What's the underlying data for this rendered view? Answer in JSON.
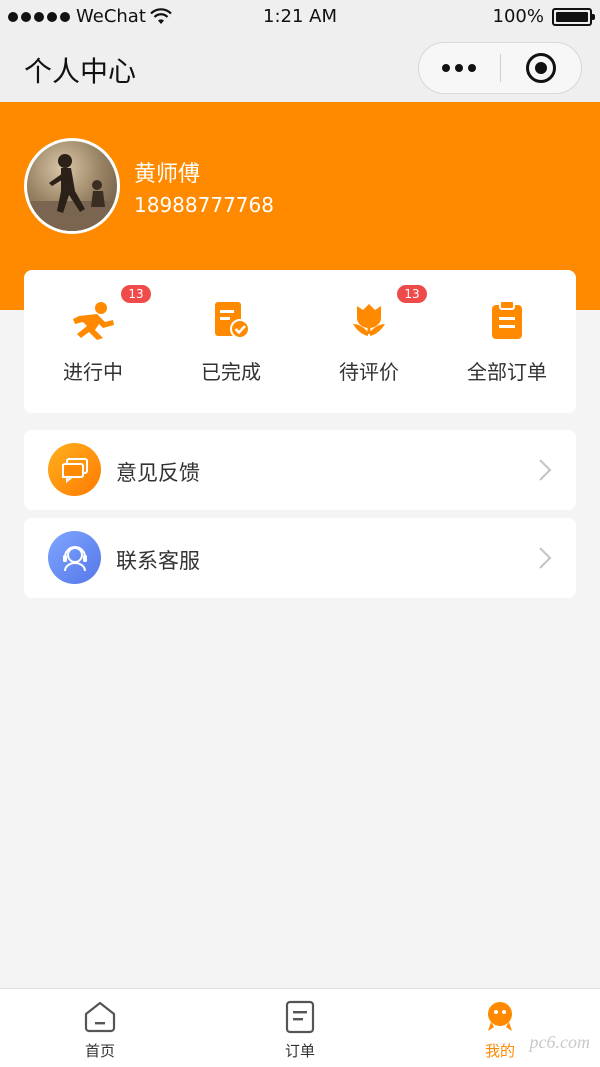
{
  "status_bar": {
    "carrier": "WeChat",
    "time": "1:21 AM",
    "battery": "100%"
  },
  "nav": {
    "title": "个人中心",
    "more_icon": "more-dots-icon",
    "close_icon": "target-circle-icon"
  },
  "profile": {
    "name": "黄师傅",
    "phone": "18988777768",
    "header_color": "#ff8a00"
  },
  "orders": {
    "items": [
      {
        "label": "进行中",
        "icon": "running-man-icon",
        "badge": "13"
      },
      {
        "label": "已完成",
        "icon": "document-check-icon",
        "badge": ""
      },
      {
        "label": "待评价",
        "icon": "flower-icon",
        "badge": "13"
      },
      {
        "label": "全部订单",
        "icon": "clipboard-icon",
        "badge": ""
      }
    ]
  },
  "menu": {
    "items": [
      {
        "label": "意见反馈",
        "icon": "feedback-chat-icon",
        "color": "#ff8a00"
      },
      {
        "label": "联系客服",
        "icon": "customer-service-icon",
        "color": "#5b86f0"
      }
    ]
  },
  "tab_bar": {
    "items": [
      {
        "label": "首页",
        "icon": "home-icon",
        "active": false
      },
      {
        "label": "订单",
        "icon": "order-list-icon",
        "active": false
      },
      {
        "label": "我的",
        "icon": "profile-mascot-icon",
        "active": true
      }
    ],
    "active_color": "#ff8a00"
  },
  "watermark": "pc6.com"
}
